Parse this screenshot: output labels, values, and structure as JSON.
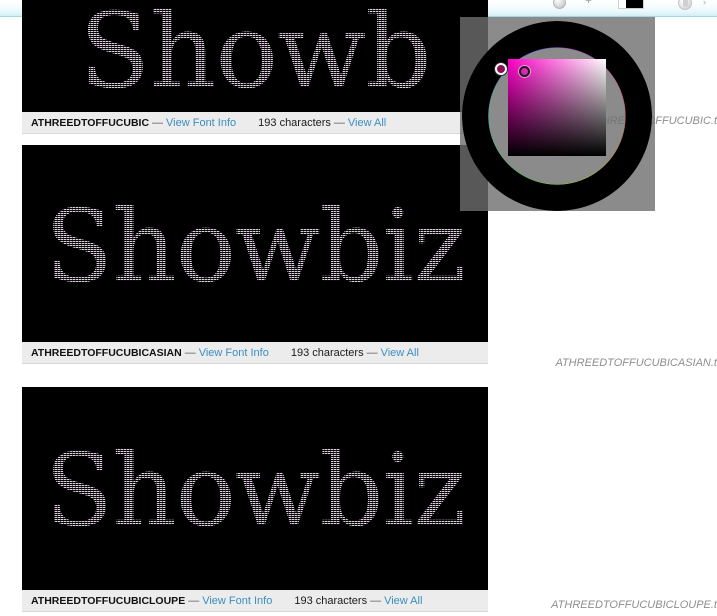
{
  "chrome": {
    "search": {
      "value": "",
      "placeholder": ""
    },
    "icons": {
      "go": "go-icon",
      "refresh": "refresh-icon",
      "plus": "plus-icon",
      "swatch": "color-swatch-icon",
      "shield": "shield-icon",
      "chevron": "chevron-down-icon"
    },
    "plus_glyph": "+",
    "chevron_glyph": "›"
  },
  "page": {
    "preview_word": "Showbiz",
    "separator": "—",
    "view_font_info_label": "View Font Info",
    "view_all_label": "View All",
    "fonts": [
      {
        "name": "ATHREEDTOFFUCUBIC",
        "characters": "193 characters",
        "watermark": "ATHREEDTOFFUCUBIC.t",
        "preview_word": "Showb"
      },
      {
        "name": "ATHREEDTOFFUCUBICASIAN",
        "characters": "193 characters",
        "watermark": "ATHREEDTOFFUCUBICASIAN.t",
        "preview_word": "Showbiz"
      },
      {
        "name": "ATHREEDTOFFUCUBICLOUPE",
        "characters": "193 characters",
        "watermark": "ATHREEDTOFFUCUBICLOUPE.t",
        "preview_word": "Showbiz"
      }
    ]
  },
  "color_picker": {
    "name": "color-picker-panel",
    "wheel_hue_deg": 312,
    "selected_color": "#8a0f55",
    "square_base_color": "#ff00c8"
  },
  "colors": {
    "link": "#3a8fc0",
    "meta_bg": "#ececec",
    "preview_bg": "#000000",
    "glyph": "#ded0e0",
    "watermark": "#8e8e8e",
    "chrome_accent": "#25b3c3"
  }
}
